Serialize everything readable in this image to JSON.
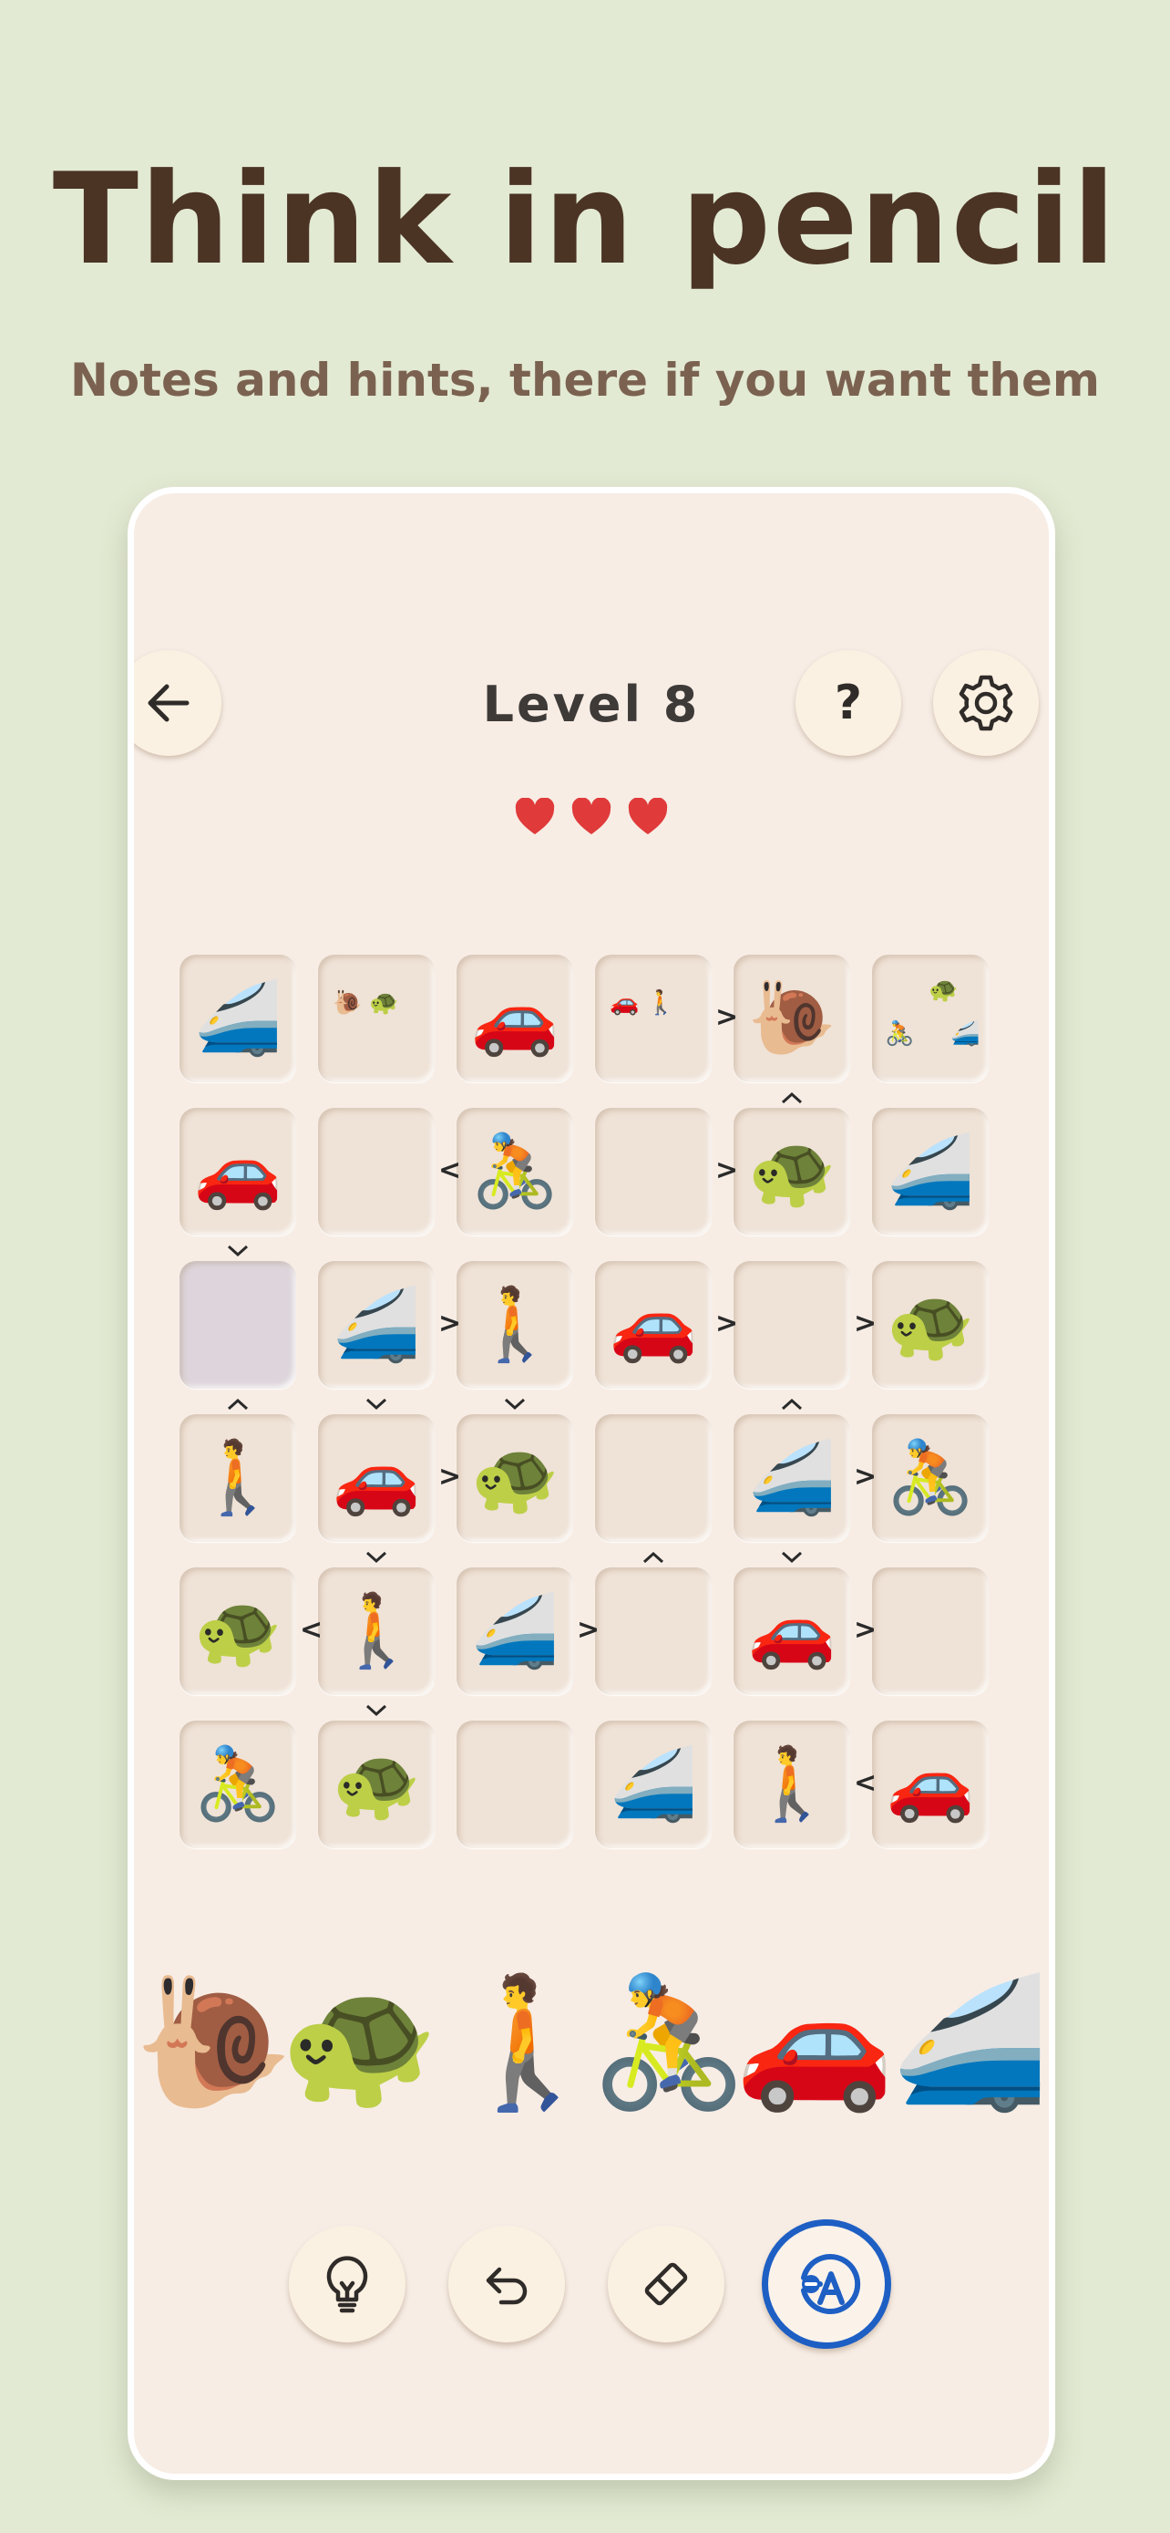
{
  "headline": "Think in pencil",
  "subheadline": "Notes and hints, there if you want them",
  "game": {
    "level_title": "Level 8",
    "lives": 3,
    "help_label": "?"
  },
  "board": [
    [
      {
        "v": "🚄"
      },
      {
        "notes": [
          "🐌",
          "🐢"
        ]
      },
      {
        "v": "🚗"
      },
      {
        "notes": [
          "🚗",
          "🚶"
        ]
      },
      {
        "v": "🐌"
      },
      {
        "notes": [
          "🐢",
          "🚴",
          "🚄"
        ]
      }
    ],
    [
      {
        "v": "🚗"
      },
      {},
      {
        "v": "🚴"
      },
      {},
      {
        "v": "🐢"
      },
      {
        "v": "🚄"
      }
    ],
    [
      {
        "selected": true
      },
      {
        "v": "🚄"
      },
      {
        "v": "🚶"
      },
      {
        "v": "🚗"
      },
      {},
      {
        "v": "🐢"
      }
    ],
    [
      {
        "v": "🚶"
      },
      {
        "v": "🚗"
      },
      {
        "v": "🐢"
      },
      {},
      {
        "v": "🚄"
      },
      {
        "v": "🚴"
      }
    ],
    [
      {
        "v": "🐢"
      },
      {
        "v": "🚶"
      },
      {
        "v": "🚄"
      },
      {},
      {
        "v": "🚗"
      },
      {}
    ],
    [
      {
        "v": "🚴"
      },
      {
        "v": "🐢"
      },
      {},
      {
        "v": "🚄"
      },
      {
        "v": "🚶"
      },
      {
        "v": "🚗"
      }
    ]
  ],
  "constraints": {
    "horizontal": [
      {
        "r": 0,
        "c": 3,
        "s": ">"
      },
      {
        "r": 1,
        "c": 1,
        "s": "<"
      },
      {
        "r": 1,
        "c": 3,
        "s": ">"
      },
      {
        "r": 2,
        "c": 1,
        "s": ">"
      },
      {
        "r": 2,
        "c": 3,
        "s": ">"
      },
      {
        "r": 2,
        "c": 4,
        "s": ">"
      },
      {
        "r": 3,
        "c": 1,
        "s": ">"
      },
      {
        "r": 3,
        "c": 4,
        "s": ">"
      },
      {
        "r": 4,
        "c": 0,
        "s": "<"
      },
      {
        "r": 4,
        "c": 2,
        "s": ">"
      },
      {
        "r": 4,
        "c": 4,
        "s": ">"
      },
      {
        "r": 5,
        "c": 4,
        "s": "<"
      }
    ],
    "vertical": [
      {
        "r": 0,
        "c": 4,
        "s": "^"
      },
      {
        "r": 1,
        "c": 0,
        "s": "v"
      },
      {
        "r": 2,
        "c": 0,
        "s": "^"
      },
      {
        "r": 2,
        "c": 1,
        "s": "v"
      },
      {
        "r": 2,
        "c": 2,
        "s": "v"
      },
      {
        "r": 2,
        "c": 4,
        "s": "^"
      },
      {
        "r": 3,
        "c": 1,
        "s": "v"
      },
      {
        "r": 3,
        "c": 3,
        "s": "^"
      },
      {
        "r": 3,
        "c": 4,
        "s": "v"
      },
      {
        "r": 4,
        "c": 1,
        "s": "v"
      }
    ]
  },
  "palette": [
    "🐌",
    "🐢",
    "🚶",
    "🚴",
    "🚗",
    "🚄"
  ],
  "icons": {
    "back": "arrow-left-icon",
    "help": "question-icon",
    "settings": "gear-icon",
    "heart": "heart-icon",
    "hint": "lightbulb-icon",
    "undo": "undo-icon",
    "erase": "eraser-icon",
    "pencil": "pencil-mode-icon"
  },
  "colors": {
    "background": "#e3ead3",
    "headline": "#4b3424",
    "subheadline": "#7b6250",
    "card": "#f7ede5",
    "heart": "#e03a3a",
    "active_tool": "#1e5fc4"
  }
}
